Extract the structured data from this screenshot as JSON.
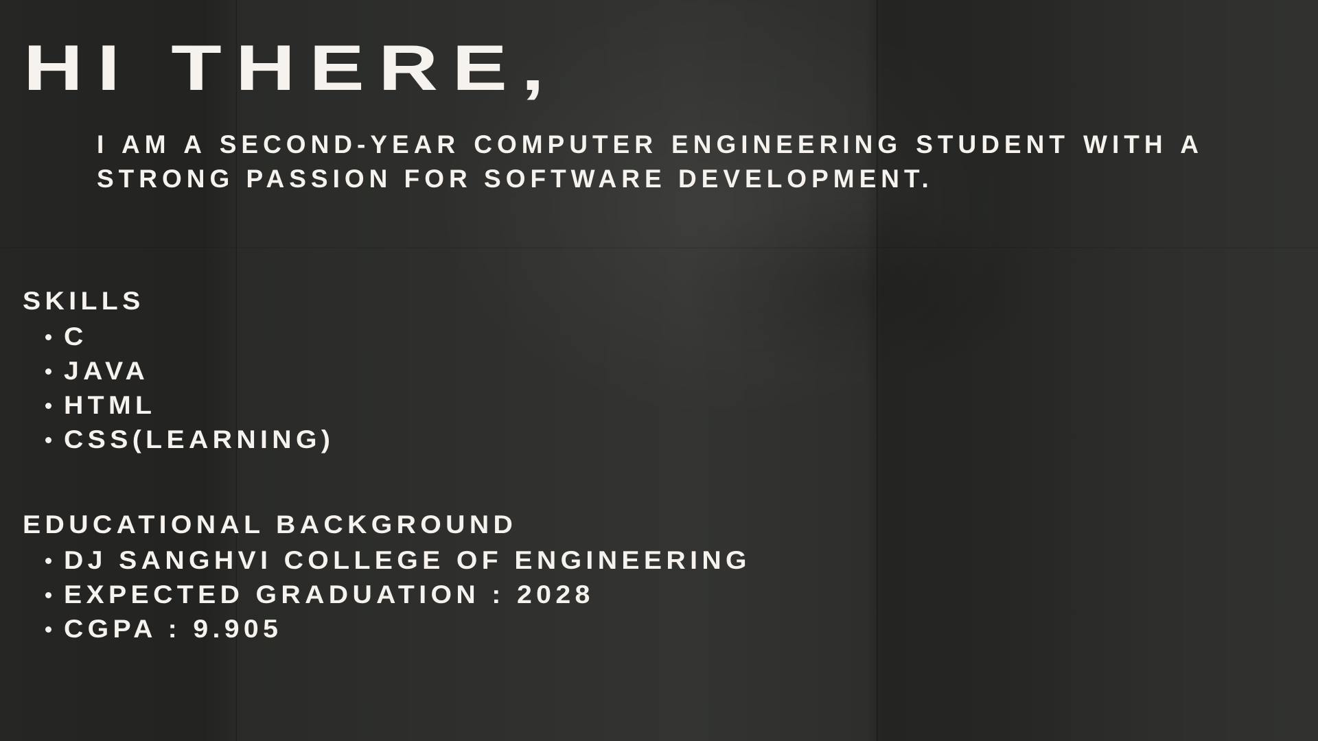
{
  "greeting": "HI THERE,",
  "intro": "I AM A SECOND-YEAR COMPUTER ENGINEERING STUDENT WITH A STRONG PASSION FOR SOFTWARE DEVELOPMENT.",
  "skills": {
    "heading": "SKILLS",
    "items": [
      {
        "label": "C"
      },
      {
        "label": "JAVA"
      },
      {
        "label": "HTML"
      },
      {
        "label": "CSS(LEARNING)"
      }
    ]
  },
  "education": {
    "heading": "EDUCATIONAL BACKGROUND",
    "items": [
      {
        "label": "DJ SANGHVI COLLEGE OF ENGINEERING"
      },
      {
        "label": "EXPECTED GRADUATION : 2028"
      },
      {
        "label": "CGPA : 9.905"
      }
    ]
  },
  "colors": {
    "background": "#2a2b28",
    "text": "#f6f3ee"
  }
}
